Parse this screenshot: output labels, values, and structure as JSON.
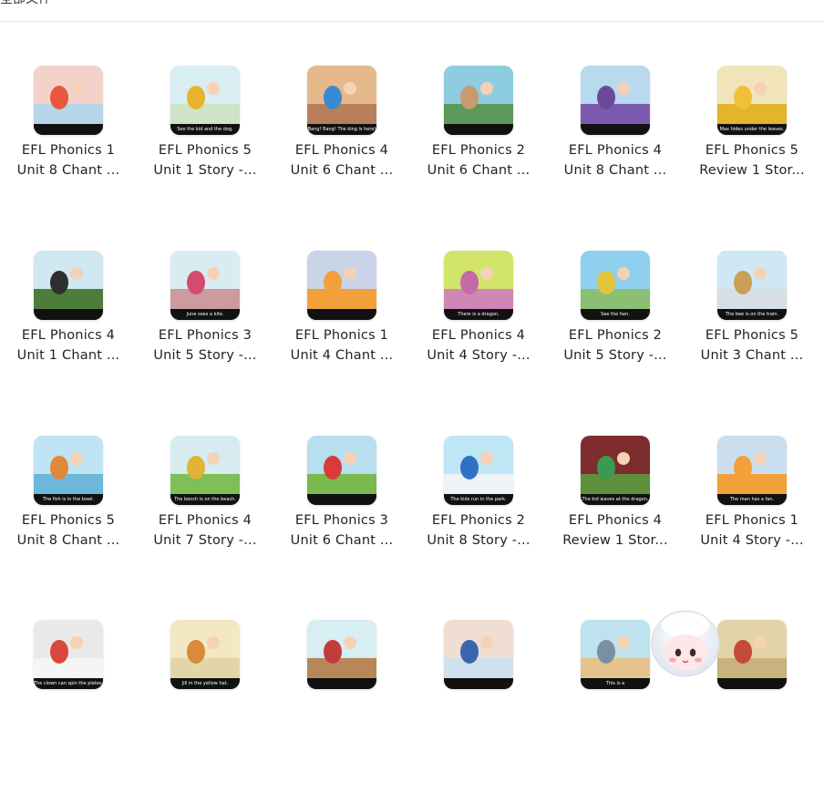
{
  "header": {
    "title": "全部文件"
  },
  "files": [
    {
      "line1": "EFL Phonics 1",
      "line2": "Unit 8 Chant ...",
      "caption": "",
      "sky": "#f3d3c9",
      "ground": "#b6d6e8",
      "accent": "#e8573e"
    },
    {
      "line1": "EFL Phonics 5",
      "line2": "Unit 1 Story -...",
      "caption": "See the kid and the dog.",
      "sky": "#d9eef2",
      "ground": "#cfe3c6",
      "accent": "#e9b22a"
    },
    {
      "line1": "EFL Phonics 4",
      "line2": "Unit 6 Chant ...",
      "caption": "Bang! Bang! The king is here!",
      "sky": "#e5b98b",
      "ground": "#b8805a",
      "accent": "#3a8ad1"
    },
    {
      "line1": "EFL Phonics 2",
      "line2": "Unit 6 Chant ...",
      "caption": "",
      "sky": "#8ecde0",
      "ground": "#5b9a5a",
      "accent": "#c79b6c"
    },
    {
      "line1": "EFL Phonics 4",
      "line2": "Unit 8 Chant ...",
      "caption": "",
      "sky": "#b9d9ef",
      "ground": "#7b5bb0",
      "accent": "#6b4a9c"
    },
    {
      "line1": "EFL Phonics 5",
      "line2": "Review 1 Stor...",
      "caption": "Max hides under the leaves.",
      "sky": "#f1e4b8",
      "ground": "#e3b52d",
      "accent": "#f0c03a"
    },
    {
      "line1": "EFL Phonics 4",
      "line2": "Unit 1 Chant ...",
      "caption": "",
      "sky": "#cfe8f2",
      "ground": "#4d7d3b",
      "accent": "#2f2f2f"
    },
    {
      "line1": "EFL Phonics 3",
      "line2": "Unit 5 Story -...",
      "caption": "June sees a kite.",
      "sky": "#d8ecf1",
      "ground": "#cb9b9e",
      "accent": "#d44b6e"
    },
    {
      "line1": "EFL Phonics 1",
      "line2": "Unit 4 Chant ...",
      "caption": "",
      "sky": "#c9d4e8",
      "ground": "#f2a13a",
      "accent": "#f2a13a"
    },
    {
      "line1": "EFL Phonics 4",
      "line2": "Unit 4 Story -...",
      "caption": "There is a dragon.",
      "sky": "#d3e46a",
      "ground": "#cf87b5",
      "accent": "#c46aa7"
    },
    {
      "line1": "EFL Phonics 2",
      "line2": "Unit 5 Story -...",
      "caption": "See the hen.",
      "sky": "#8fd0ee",
      "ground": "#8bbf73",
      "accent": "#e2c53a"
    },
    {
      "line1": "EFL Phonics 5",
      "line2": "Unit 3 Chant ...",
      "caption": "The bee is on the train.",
      "sky": "#cfe8f5",
      "ground": "#d6dfe4",
      "accent": "#c9a055"
    },
    {
      "line1": "EFL Phonics 5",
      "line2": "Unit 8 Chant ...",
      "caption": "The fish is in the bowl.",
      "sky": "#bfe4f3",
      "ground": "#6db8d8",
      "accent": "#e1863a"
    },
    {
      "line1": "EFL Phonics 4",
      "line2": "Unit 7 Story -...",
      "caption": "The bench is on the beach.",
      "sky": "#d7ecf0",
      "ground": "#7fbf57",
      "accent": "#e2b236"
    },
    {
      "line1": "EFL Phonics 3",
      "line2": "Unit 6 Chant ...",
      "caption": "",
      "sky": "#b8dff0",
      "ground": "#79b94e",
      "accent": "#d93a3a"
    },
    {
      "line1": "EFL Phonics 2",
      "line2": "Unit 8 Story -...",
      "caption": "The kids run in the park.",
      "sky": "#bfe6f5",
      "ground": "#eef4f6",
      "accent": "#2f72c4"
    },
    {
      "line1": "EFL Phonics 4",
      "line2": "Review 1 Stor...",
      "caption": "The kid waves at the dragon.",
      "sky": "#7d2d2d",
      "ground": "#5f8f3a",
      "accent": "#3a9a52"
    },
    {
      "line1": "EFL Phonics 1",
      "line2": "Unit 4 Story -...",
      "caption": "The man has a fan.",
      "sky": "#c9dff0",
      "ground": "#f2a13a",
      "accent": "#f2a13a"
    },
    {
      "line1": "",
      "line2": "",
      "caption": "The clown can spin the plates.",
      "sky": "#e9e9e9",
      "ground": "#f5f5f5",
      "accent": "#d9483c"
    },
    {
      "line1": "",
      "line2": "",
      "caption": "Jill in the yellow hat.",
      "sky": "#f3e7c4",
      "ground": "#e2d6a8",
      "accent": "#d98a3a"
    },
    {
      "line1": "",
      "line2": "",
      "caption": "",
      "sky": "#d7eef2",
      "ground": "#b7875a",
      "accent": "#c23b3b"
    },
    {
      "line1": "",
      "line2": "",
      "caption": "",
      "sky": "#f1ded3",
      "ground": "#cfe0ef",
      "accent": "#3a66b0"
    },
    {
      "line1": "",
      "line2": "",
      "caption": "This is a",
      "sky": "#bfe2ef",
      "ground": "#e6c38c",
      "accent": "#7b8fa3"
    },
    {
      "line1": "",
      "line2": "",
      "caption": "",
      "sky": "#e2d3a9",
      "ground": "#c9b27c",
      "accent": "#c44a3a"
    }
  ]
}
